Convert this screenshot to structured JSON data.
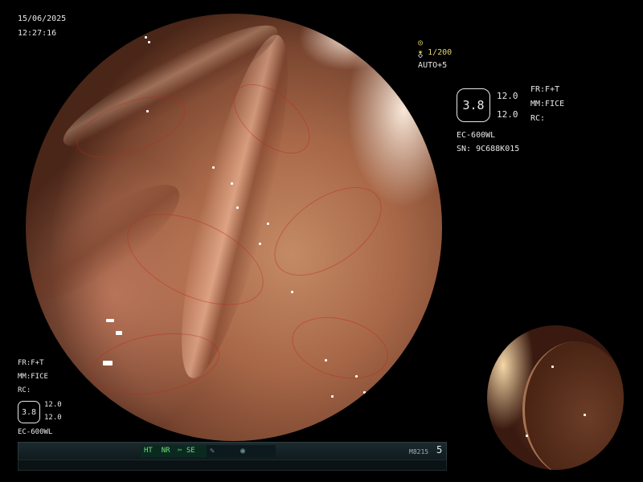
{
  "datetime": {
    "date": "15/06/2025",
    "time": "12:27:16"
  },
  "shutter": {
    "value": "✶ 1/200",
    "auto": "AUTO+5",
    "icon_shutter": "aperture-icon",
    "icon_auto": "auto-exposure-icon"
  },
  "right_panel": {
    "scale_value": "3.8",
    "zoom_top": "12.0",
    "zoom_bottom": "12.0",
    "fr": "FR:F+T",
    "mm": "MM:FICE",
    "rc": "RC:",
    "model": "EC-600WL",
    "serial": "SN: 9C688K015"
  },
  "left_panel": {
    "fr": "FR:F+T",
    "mm": "MM:FICE",
    "rc": "RC:",
    "scale_value": "3.8",
    "zoom_top": "12.0",
    "zoom_bottom": "12.0",
    "model": "EC-600WL"
  },
  "statusbar": {
    "ht": "HT",
    "nr": "NR",
    "se": "SE",
    "code": "M8215",
    "number": "5",
    "icons": [
      "scissors-icon",
      "pen-icon",
      "record-icon"
    ],
    "accent": "#6ee07a"
  }
}
